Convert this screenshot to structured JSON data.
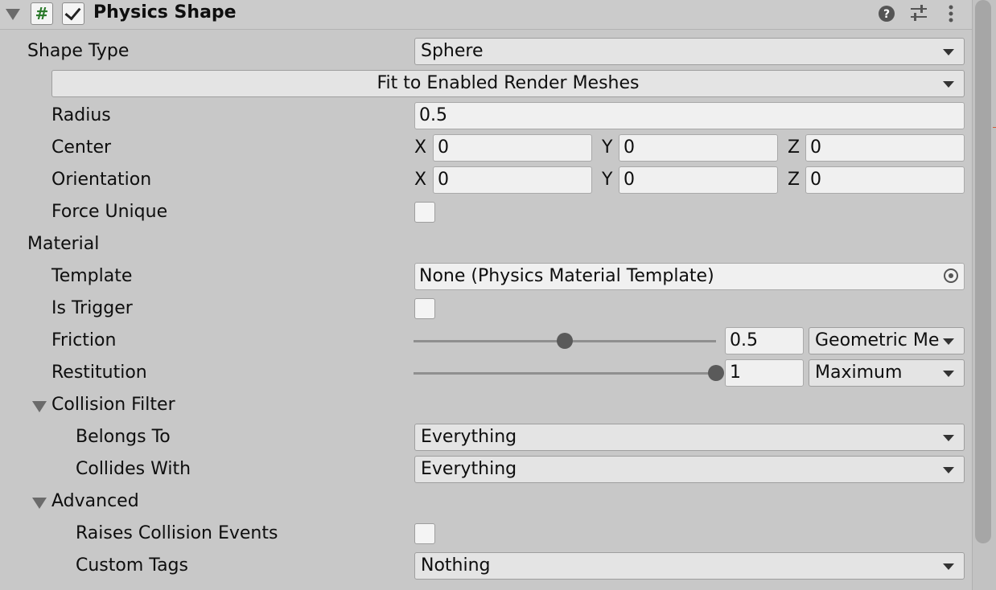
{
  "header": {
    "title": "Physics Shape",
    "script_glyph": "#",
    "enabled": true,
    "icons": [
      "help-icon",
      "presets-icon",
      "more-icon"
    ]
  },
  "shape": {
    "type_label": "Shape Type",
    "type_value": "Sphere",
    "fit_button": "Fit to Enabled Render Meshes",
    "radius_label": "Radius",
    "radius_value": "0.5",
    "center_label": "Center",
    "center": {
      "x": "0",
      "y": "0",
      "z": "0"
    },
    "orientation_label": "Orientation",
    "orientation": {
      "x": "0",
      "y": "0",
      "z": "0"
    },
    "axis_labels": {
      "x": "X",
      "y": "Y",
      "z": "Z"
    },
    "force_unique_label": "Force Unique",
    "force_unique": false
  },
  "material": {
    "section_label": "Material",
    "template_label": "Template",
    "template_value": "None (Physics Material Template)",
    "is_trigger_label": "Is Trigger",
    "is_trigger": false,
    "friction_label": "Friction",
    "friction_value": "0.5",
    "friction_slider_fraction": 0.5,
    "friction_combine": "Geometric Me",
    "restitution_label": "Restitution",
    "restitution_value": "1",
    "restitution_slider_fraction": 1.0,
    "restitution_combine": "Maximum"
  },
  "collision_filter": {
    "section_label": "Collision Filter",
    "belongs_to_label": "Belongs To",
    "belongs_to_value": "Everything",
    "collides_with_label": "Collides With",
    "collides_with_value": "Everything"
  },
  "advanced": {
    "section_label": "Advanced",
    "raises_events_label": "Raises Collision Events",
    "raises_events": false,
    "custom_tags_label": "Custom Tags",
    "custom_tags_value": "Nothing"
  },
  "colors": {
    "panel_bg": "#c8c8c8",
    "field_bg": "#f0f0f0",
    "script_icon": "#2b7a2b"
  }
}
